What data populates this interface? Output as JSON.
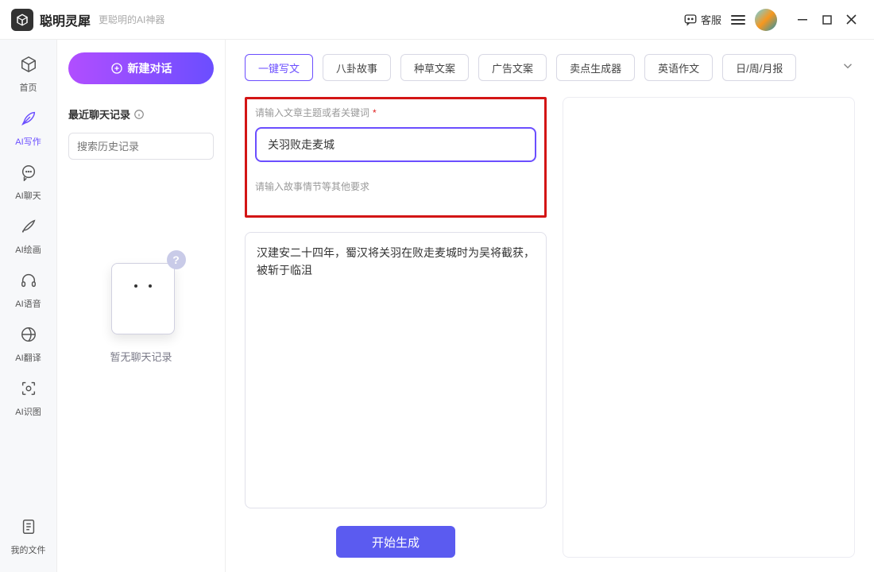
{
  "titlebar": {
    "app_name": "聪明灵犀",
    "tagline": "更聪明的AI神器",
    "support": "客服"
  },
  "leftnav": {
    "items": [
      {
        "label": "首页",
        "icon": "home"
      },
      {
        "label": "AI写作",
        "icon": "feather",
        "active": true
      },
      {
        "label": "AI聊天",
        "icon": "chat"
      },
      {
        "label": "AI绘画",
        "icon": "brush"
      },
      {
        "label": "AI语音",
        "icon": "headset"
      },
      {
        "label": "AI翻译",
        "icon": "translate"
      },
      {
        "label": "AI识图",
        "icon": "scan"
      }
    ],
    "footer": {
      "label": "我的文件",
      "icon": "file"
    }
  },
  "midcol": {
    "new_chat": "新建对话",
    "recent_title": "最近聊天记录",
    "search_placeholder": "搜索历史记录",
    "empty_text": "暂无聊天记录"
  },
  "tabs": [
    {
      "label": "一键写文",
      "active": true
    },
    {
      "label": "八卦故事"
    },
    {
      "label": "种草文案"
    },
    {
      "label": "广告文案"
    },
    {
      "label": "卖点生成器"
    },
    {
      "label": "英语作文"
    },
    {
      "label": "日/周/月报"
    }
  ],
  "form": {
    "topic_label": "请输入文章主题或者关键词",
    "topic_value": "关羽败走麦城",
    "detail_label": "请输入故事情节等其他要求",
    "detail_value": "汉建安二十四年，蜀汉将关羽在败走麦城时为吴将截获，被斩于临沮",
    "generate": "开始生成"
  }
}
